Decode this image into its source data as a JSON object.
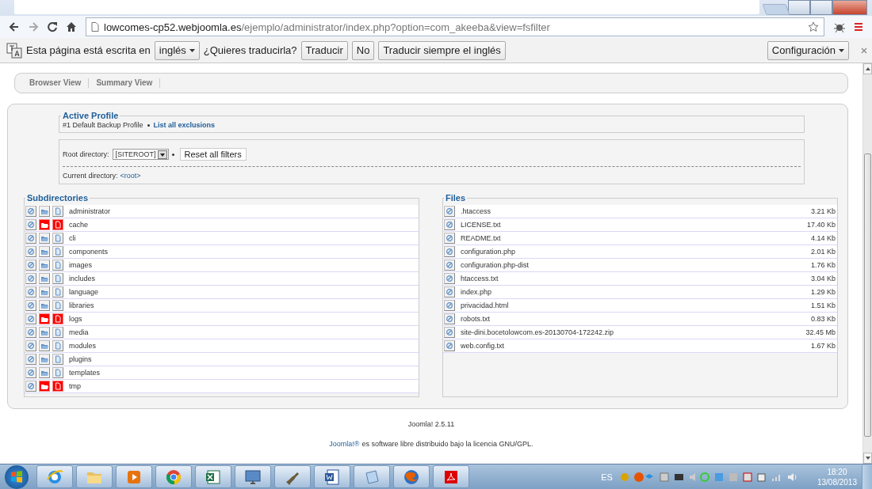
{
  "browser": {
    "url_host": "lowcomes-cp52.webjoomla.es",
    "url_path": "/ejemplo/administrator/index.php?option=com_akeeba&view=fsfilter"
  },
  "translate_bar": {
    "prompt": "Esta página está escrita en",
    "language": "inglés",
    "question": "¿Quieres traducirla?",
    "buttons": [
      "Traducir",
      "No",
      "Traducir siempre el inglés"
    ],
    "settings": "Configuración"
  },
  "tabs": [
    {
      "label": "Browser View",
      "selected": false
    },
    {
      "label": "Summary View",
      "selected": false
    }
  ],
  "active_profile": {
    "title": "Active Profile",
    "profile": "#1 Default Backup Profile",
    "link": "List all exclusions"
  },
  "filters": {
    "root_label": "Root directory:",
    "root_value": "[SITEROOT]",
    "reset_button": "Reset all filters",
    "current_label": "Current directory:",
    "current_value": "<root>"
  },
  "subdirectories": {
    "title": "Subdirectories",
    "items": [
      {
        "name": "administrator",
        "skip_dirs": false,
        "skip_files": false
      },
      {
        "name": "cache",
        "skip_dirs": true,
        "skip_files": true
      },
      {
        "name": "cli",
        "skip_dirs": false,
        "skip_files": false
      },
      {
        "name": "components",
        "skip_dirs": false,
        "skip_files": false
      },
      {
        "name": "images",
        "skip_dirs": false,
        "skip_files": false
      },
      {
        "name": "includes",
        "skip_dirs": false,
        "skip_files": false
      },
      {
        "name": "language",
        "skip_dirs": false,
        "skip_files": false
      },
      {
        "name": "libraries",
        "skip_dirs": false,
        "skip_files": false
      },
      {
        "name": "logs",
        "skip_dirs": true,
        "skip_files": true
      },
      {
        "name": "media",
        "skip_dirs": false,
        "skip_files": false
      },
      {
        "name": "modules",
        "skip_dirs": false,
        "skip_files": false
      },
      {
        "name": "plugins",
        "skip_dirs": false,
        "skip_files": false
      },
      {
        "name": "templates",
        "skip_dirs": false,
        "skip_files": false
      },
      {
        "name": "tmp",
        "skip_dirs": true,
        "skip_files": true
      }
    ]
  },
  "files": {
    "title": "Files",
    "items": [
      {
        "name": ".htaccess",
        "size": "3.21 Kb"
      },
      {
        "name": "LICENSE.txt",
        "size": "17.40 Kb"
      },
      {
        "name": "README.txt",
        "size": "4.14 Kb"
      },
      {
        "name": "configuration.php",
        "size": "2.01 Kb"
      },
      {
        "name": "configuration.php-dist",
        "size": "1.76 Kb"
      },
      {
        "name": "htaccess.txt",
        "size": "3.04 Kb"
      },
      {
        "name": "index.php",
        "size": "1.29 Kb"
      },
      {
        "name": "privacidad.html",
        "size": "1.51 Kb"
      },
      {
        "name": "robots.txt",
        "size": "0.83 Kb"
      },
      {
        "name": "site-dini.bocetolowcom.es-20130704-172242.zip",
        "size": "32.45 Mb"
      },
      {
        "name": "web.config.txt",
        "size": "1.67 Kb"
      }
    ]
  },
  "footer": {
    "version": "Joomla! 2.5.11",
    "license_link": "Joomla!®",
    "license_text": "es software libre distribuido bajo la licencia GNU/GPL."
  },
  "taskbar": {
    "language": "ES",
    "time": "18:20",
    "date": "13/08/2013"
  }
}
